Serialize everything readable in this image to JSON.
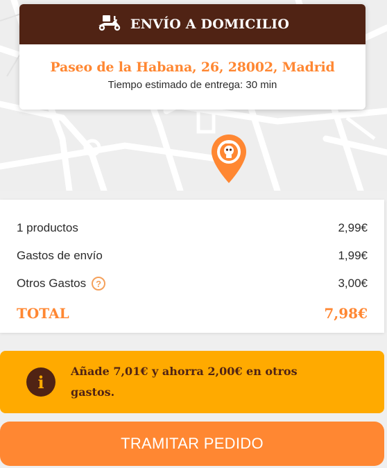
{
  "delivery": {
    "title": "ENVÍO A DOMICILIO",
    "address": "Paseo de la Habana, 26, 28002, Madrid",
    "eta": "Tiempo estimado de entrega: 30 min"
  },
  "map": {
    "pin_icon": "location-pin-icon",
    "pin_color": "#ff8732"
  },
  "summary": {
    "rows": [
      {
        "label": "1 productos",
        "value": "2,99€"
      },
      {
        "label": "Gastos de envío",
        "value": "1,99€"
      },
      {
        "label": "Otros Gastos",
        "value": "3,00€"
      }
    ],
    "total_label": "TOTAL",
    "total_value": "7,98€"
  },
  "promo": {
    "text": "Añade 7,01€ y ahorra 2,00€ en otros gastos.",
    "icon": "info-icon"
  },
  "cta": {
    "label": "TRAMITAR PEDIDO"
  },
  "colors": {
    "brand_brown": "#502314",
    "accent_orange": "#ff8732",
    "promo_yellow": "#ffaa00"
  }
}
